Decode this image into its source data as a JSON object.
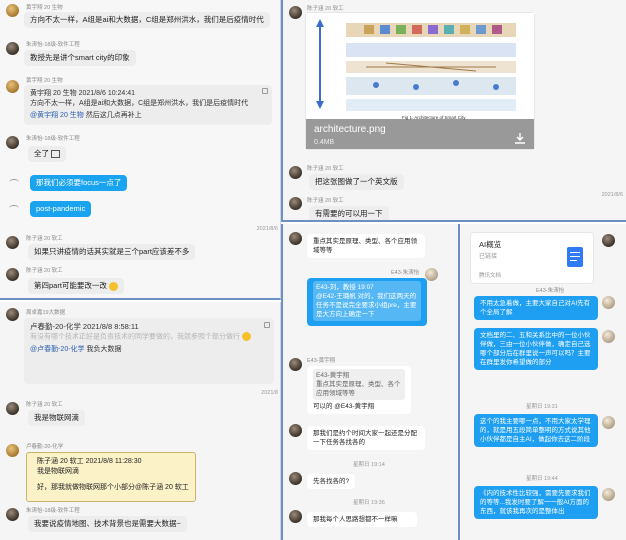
{
  "p1": {
    "m1": {
      "name": "黄宇翔 20 生物",
      "text": "方向不太一样，A组是ai和大数据，C组是郑州洪水，我们是后疫情时代"
    },
    "m2": {
      "name": "朱涛怡-18级-软件工程",
      "text": "教授先是讲个smart city的印象"
    },
    "m3": {
      "name": "黄宇翔 20 生物",
      "quote_head": "黄宇翔 20 生物  2021/8/6 10:24:41",
      "quote_body": "方向不太一样，A组是ai和大数据，C组是郑州洪水，我们是后疫情时代",
      "mention": "@黄宇翔 20 生物",
      "tail": " 然后这几点再补上"
    },
    "m4": {
      "name": "朱涛怡-18级-软件工程",
      "text": "全了"
    },
    "m5": {
      "text": "那我们必须要focus一点了"
    },
    "m6": {
      "text": "post-pandemic"
    },
    "m7": {
      "name": "陈子涵 20 软工",
      "time": "2021/8/6",
      "text": "如果只讲疫情的话其实就是三个part应该差不多"
    },
    "m8": {
      "name": "陈子涵 20 软工",
      "text": "第四part可能要改一改"
    }
  },
  "p2": {
    "m1": {
      "name": "周卓嘉19大数据",
      "quote_head": "卢春勤-20-化学  2021/8/8 8:58:11",
      "quote_body": "有没有哪个技术正好是负责技术的同学要做的，我就参照个部分做行",
      "mention": "@卢春勤-20-化学",
      "tail": " 我负大数据"
    },
    "m2": {
      "name": "陈子涵 20 软工",
      "text": "我是物联网滴"
    },
    "m3": {
      "name": "卢春勤-20-化学",
      "quote_head": "陈子涵 20 软工  2021/8/8 11:28:30",
      "quote_body": "我是物联网滴",
      "tail_pre": "好，那我就做物联网那个小部分",
      "mention": "@陈子涵 20 软工"
    },
    "m4": {
      "name": "朱涛怡-18级-软件工程",
      "text": "我要说疫情地图、技术背景也是需要大数据~"
    },
    "time_right": "2021/8"
  },
  "p3": {
    "file_name": "architecture.png",
    "file_size": "0.4MB",
    "fig_caption": "Fig 1.  Architecture of Smart City",
    "m1": {
      "name": "陈子涵 20 软工"
    },
    "m2": {
      "name": "陈子涵 20 软工",
      "text": "把这张图做了一个英文版"
    },
    "m3": {
      "name": "陈子涵 20 软工",
      "text": "有需要的可以用一下"
    },
    "time_right": "2021/8/6"
  },
  "p4": {
    "m1": {
      "text": "重点其实是原理、类型、各个应用领域等等"
    },
    "m2": {
      "name": "E43-朱涛怡",
      "quote_head": "E43-刘，教授 19:07",
      "quote_body": "@E42-王璐帆 对的，我们这两天的任务不是说完全要求小组pre，主要是大方向上确定一下",
      "text": "可以的  @E43-黄宇翔"
    },
    "m3": {
      "name": "E43-黄宇翔",
      "quote_head": "E43-黄宇翔",
      "quote_body": "重点其实是原理、类型、各个应用领域等等",
      "text": "可以的  @E43-黄宇翔"
    },
    "m4": {
      "text": "那我们是约个时间大家一起还是分配一下任务各找各的"
    },
    "time": "星期日 19:14",
    "m5": {
      "text": "先各找各的?"
    },
    "time2": "星期日 19:36",
    "m6": {
      "text": "那我每个人思路想都不一样嘛"
    }
  },
  "p5": {
    "doc_title": "AI概览",
    "doc_sub": "已链接",
    "doc_footer": "腾讯文档",
    "m1": {
      "name": "E43-朱涛怡",
      "text": "不用太急着做，主要大家自己对AI先有个全局了解"
    },
    "m2": {
      "text": "文档里的二、五和关系比中的一位小伙伴做，三由一位小伙伴做，确定自己选哪个部分后在群里说一声可以吗？主要在群里发你希望做的部分"
    },
    "time": "星期日 19:31",
    "m3": {
      "text": "这个的我主要哪一点，不用大家太学理的，就是用五段简单整明的方式说其他小伙伴都是自主AI，做起你去这二阶段"
    },
    "m4": {
      "text": "《内的技术性比较强，需要先要求我们的等等...我发时要了解一一般AI方面的东西，就该我再次的是整体出"
    },
    "time2": "星期日 19:44"
  },
  "colors": {
    "accent_blue": "#1aa3ee",
    "divider": "#6d8fc4"
  }
}
